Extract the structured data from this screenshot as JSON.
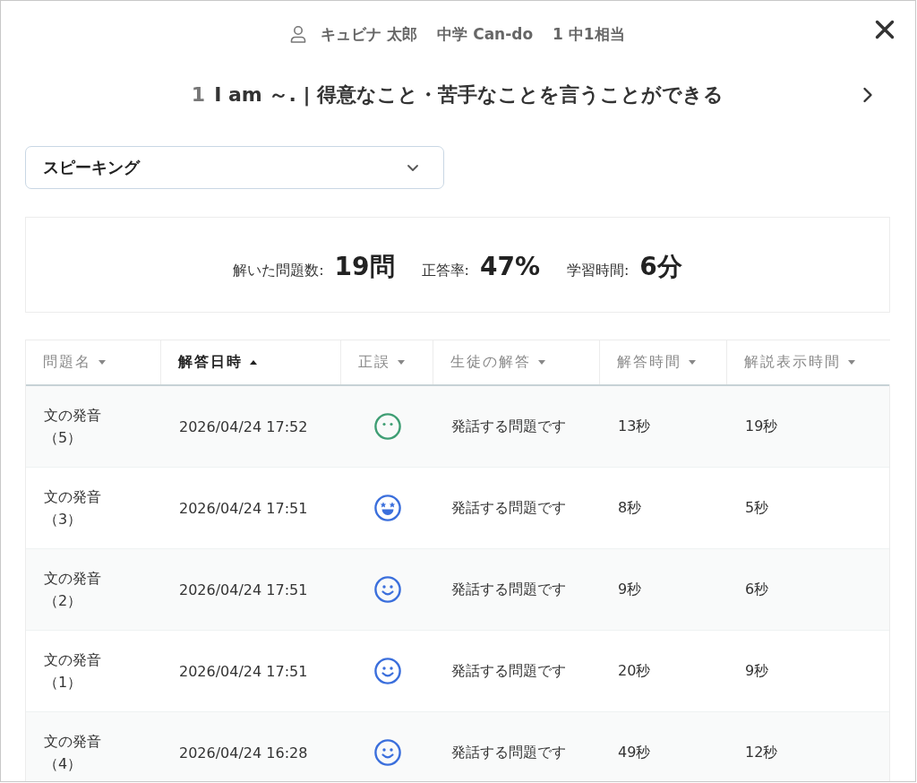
{
  "header": {
    "student_name": "キュビナ 太郎",
    "course": "中学 Can-do",
    "grade": "1 中1相当"
  },
  "title": {
    "number": "1",
    "text": "I am ～. | 得意なこと・苦手なことを言うことができる"
  },
  "skill_select": {
    "value": "スピーキング"
  },
  "stats": [
    {
      "label": "解いた問題数:",
      "value": "19問"
    },
    {
      "label": "正答率:",
      "value": "47%"
    },
    {
      "label": "学習時間:",
      "value": "6分"
    }
  ],
  "table": {
    "columns": [
      {
        "label": "問題名",
        "selected": false
      },
      {
        "label": "解答日時",
        "selected": true
      },
      {
        "label": "正誤",
        "selected": false
      },
      {
        "label": "生徒の解答",
        "selected": false
      },
      {
        "label": "解答時間",
        "selected": false
      },
      {
        "label": "解説表示時間",
        "selected": false
      }
    ],
    "rows": [
      {
        "problem": "文の発音（5）",
        "answered_at": "2026/04/24 17:52",
        "kind": "neutral",
        "student_answer": "発話する問題です",
        "answer_time": "13秒",
        "explanation_time": "19秒"
      },
      {
        "problem": "文の発音（3）",
        "answered_at": "2026/04/24 17:51",
        "kind": "excellent",
        "student_answer": "発話する問題です",
        "answer_time": "8秒",
        "explanation_time": "5秒"
      },
      {
        "problem": "文の発音（2）",
        "answered_at": "2026/04/24 17:51",
        "kind": "good",
        "student_answer": "発話する問題です",
        "answer_time": "9秒",
        "explanation_time": "6秒"
      },
      {
        "problem": "文の発音（1）",
        "answered_at": "2026/04/24 17:51",
        "kind": "good",
        "student_answer": "発話する問題です",
        "answer_time": "20秒",
        "explanation_time": "9秒"
      },
      {
        "problem": "文の発音（4）",
        "answered_at": "2026/04/24 16:28",
        "kind": "good",
        "student_answer": "発話する問題です",
        "answer_time": "49秒",
        "explanation_time": "12秒"
      }
    ]
  }
}
